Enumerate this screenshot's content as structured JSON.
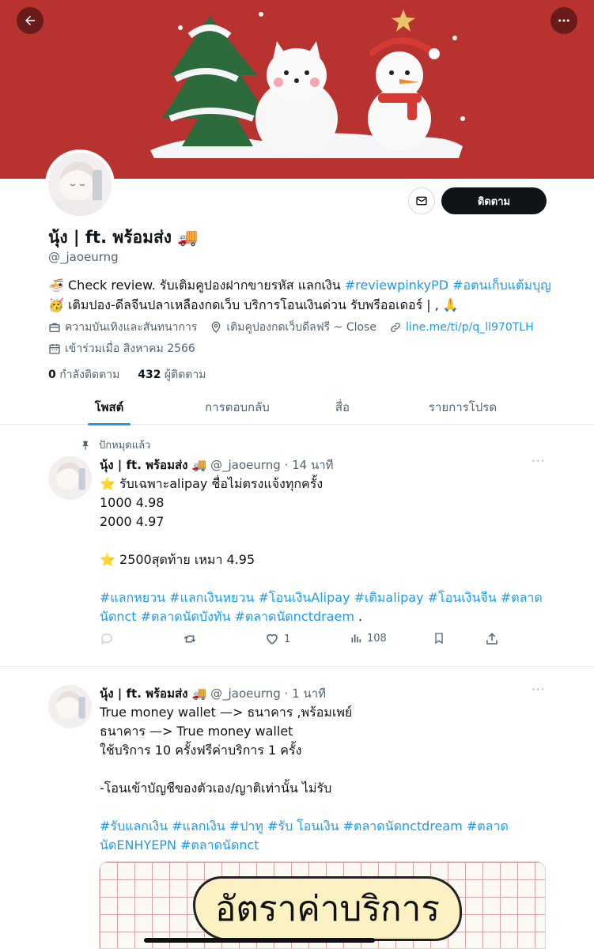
{
  "profile": {
    "name": "นุ้ง | ft. พร้อมส่ง 🚚",
    "handle": "@_jaoeurng",
    "bio_parts": [
      {
        "text": "🍜 Check review. รับเติมคูปองฝากขายรหัส แลกเงิน ",
        "link": false
      },
      {
        "text": "#reviewpinkyPD",
        "link": true
      },
      {
        "text": " ",
        "link": false
      },
      {
        "text": "#อตนเก็บแต้มบุญ",
        "link": true
      },
      {
        "text": " 🥳 เติมปอง-ดีลจีนปลาเหลืองกดเว็บ บริการโอนเงินด่วน รับพรีออเดอร์ | , 🙏",
        "link": false
      }
    ],
    "category": "ความบันเทิงและสันทนาการ",
    "location": "เติมคูปองกดเว็บดีลฟรี ~ Close",
    "website": "line.me/ti/p/q_ll970TLH",
    "joined": "เข้าร่วมเมื่อ สิงหาคม 2566",
    "following_count": "0",
    "following_label": "กำลังติดตาม",
    "followers_count": "432",
    "followers_label": "ผู้ติดตาม",
    "follow_button": "ติดตาม",
    "icons": {
      "back": "back-arrow-icon",
      "more": "more-dots-icon",
      "message": "envelope-icon",
      "category": "briefcase-icon",
      "location": "location-pin-icon",
      "website": "link-icon",
      "joined": "calendar-icon"
    }
  },
  "tabs": [
    {
      "label": "โพสต์",
      "active": true
    },
    {
      "label": "การตอบกลับ",
      "active": false
    },
    {
      "label": "สื่อ",
      "active": false
    },
    {
      "label": "รายการโปรด",
      "active": false
    }
  ],
  "tweets": [
    {
      "pinned_label": "ปักหมุดแล้ว",
      "author": "นุ้ง | ft. พร้อมส่ง 🚚",
      "handle_time": "@_jaoeurng · 14 นาที",
      "body": "⭐ รับเฉพาะalipay ชื่อไม่ตรงแจ้งทุกครั้ง\n1000 4.98\n2000 4.97\n\n⭐ 2500สุดท้าย เหมา 4.95",
      "tags": "#แลกหยวน #แลกเงินหยวน #โอนเงินAlipay #เติมalipay #โอนเงินจีน #ตลาดนัดnct #ตลาดนัดบังทัน #ตลาดนัดnctdraem",
      "tags_tail": " .",
      "likes": "1",
      "views": "108"
    },
    {
      "author": "นุ้ง | ft. พร้อมส่ง 🚚",
      "handle_time": "@_jaoeurng · 1 นาที",
      "body": "True money wallet —> ธนาคาร ,พร้อมเพย์\nธนาคาร —> True money wallet\nใช้บริการ 10 ครั้งฟรีค่าบริการ 1 ครั้ง\n\n-โอนเข้าบัญชีของตัวเอง/ญาติเท่านั้น ไม่รับ",
      "tags": "#รับแลกเงิน #แลกเงิน  #ปาทู #รับ โอนเงิน #ตลาดนัดnctdream  #ตลาดนัดENHYEPN  #ตลาดนัดnct",
      "media_text": "อัตราค่าบริการ"
    }
  ],
  "colors": {
    "accent": "#1d9bf0",
    "banner": "#b83230",
    "text": "#0f1419",
    "secondary": "#536471"
  }
}
